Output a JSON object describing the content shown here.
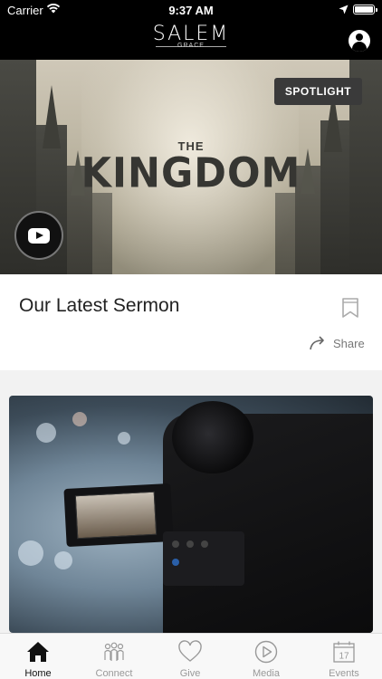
{
  "status_bar": {
    "carrier": "Carrier",
    "time": "9:37 AM",
    "icons": [
      "wifi-icon",
      "location-arrow-icon",
      "battery-icon"
    ]
  },
  "header": {
    "brand": "SALEM",
    "brand_sub": "GRACE",
    "profile_icon": "user-circle-icon"
  },
  "hero": {
    "title_small": "THE",
    "title_large": "KINGDOM",
    "badge": "SPOTLIGHT",
    "video_icon": "youtube-play-icon"
  },
  "sermon_card": {
    "title": "Our Latest Sermon",
    "bookmark_icon": "bookmark-icon",
    "share_label": "Share"
  },
  "media_card": {
    "image": "video-camera-photo"
  },
  "tabbar": {
    "active_color": "#111111",
    "inactive_color": "#999999",
    "tabs": [
      {
        "label": "Home",
        "icon": "home-icon",
        "active": true
      },
      {
        "label": "Connect",
        "icon": "people-icon",
        "active": false
      },
      {
        "label": "Give",
        "icon": "heart-icon",
        "active": false
      },
      {
        "label": "Media",
        "icon": "play-circle-icon",
        "active": false
      },
      {
        "label": "Events",
        "icon": "calendar-icon",
        "active": false,
        "badge_number": "17"
      }
    ]
  }
}
